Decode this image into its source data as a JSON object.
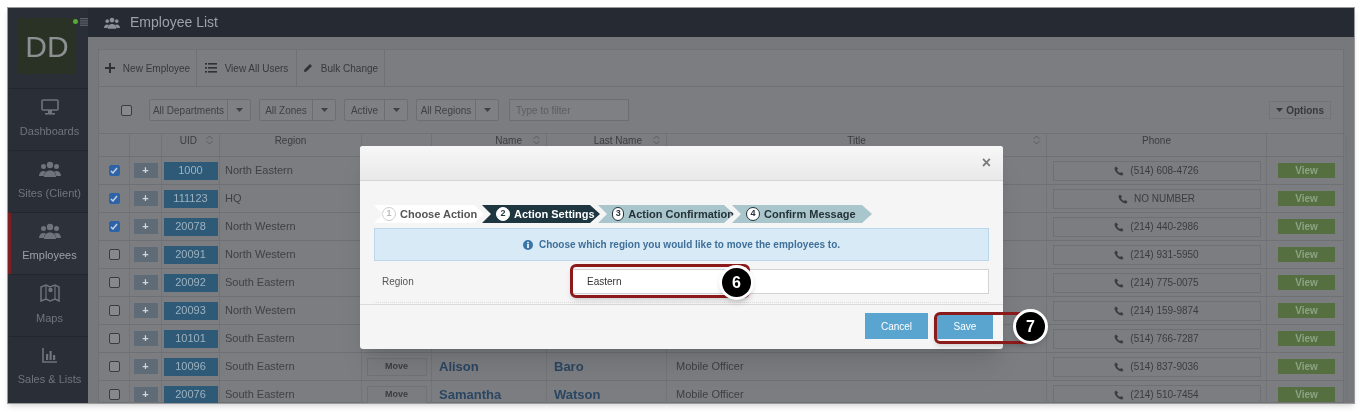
{
  "sidebar": {
    "avatar": "DD",
    "online": true,
    "items": [
      {
        "label": "Dashboards",
        "selected": false
      },
      {
        "label": "Sites (Client)",
        "selected": false
      },
      {
        "label": "Employees",
        "selected": true
      },
      {
        "label": "Maps",
        "selected": false
      },
      {
        "label": "Sales & Lists",
        "selected": false
      }
    ]
  },
  "header": {
    "title": "Employee List"
  },
  "toolbar": [
    "New Employee",
    "View All Users",
    "Bulk Change"
  ],
  "filters": {
    "select_all_checked": false,
    "dropdowns": [
      "All Departments",
      "All Zones",
      "Active",
      "All Regions"
    ],
    "search": {
      "placeholder": "Type to filter"
    },
    "options_button": "Options"
  },
  "table": {
    "columns": [
      {
        "label": "UID",
        "sortable": true
      },
      {
        "label": "Region",
        "sortable": false
      },
      {
        "label": "Name",
        "sortable": true
      },
      {
        "label": "Last Name",
        "sortable": true
      },
      {
        "label": "Title",
        "sortable": true
      },
      {
        "label": "Phone",
        "sortable": false
      }
    ],
    "rows": [
      {
        "checked": true,
        "expand": "+",
        "uid": "1000",
        "region": "North Eastern",
        "phone": "(514) 608-4726",
        "view": "View"
      },
      {
        "checked": true,
        "expand": "+",
        "uid": "111123",
        "region": "HQ",
        "phone": "NO NUMBER",
        "view": "View"
      },
      {
        "checked": true,
        "expand": "+",
        "uid": "20078",
        "region": "North Western",
        "phone": "(214) 440-2986",
        "view": "View"
      },
      {
        "checked": false,
        "expand": "+",
        "uid": "20091",
        "region": "North Western",
        "phone": "(214) 931-5950",
        "view": "View"
      },
      {
        "checked": false,
        "expand": "+",
        "uid": "20092",
        "region": "South Eastern",
        "phone": "(214) 775-0075",
        "view": "View"
      },
      {
        "checked": false,
        "expand": "+",
        "uid": "20093",
        "region": "North Western",
        "phone": "(214) 159-9874",
        "view": "View"
      },
      {
        "checked": false,
        "expand": "+",
        "uid": "10101",
        "region": "South Eastern",
        "phone": "(514) 766-7287",
        "view": "View"
      },
      {
        "checked": false,
        "expand": "+",
        "uid": "10096",
        "region": "South Eastern",
        "move": "Move",
        "first_name": "Alison",
        "last_name": "Baro",
        "title": "Mobile Officer",
        "phone": "(514) 837-9036",
        "view": "View"
      },
      {
        "checked": false,
        "expand": "+",
        "uid": "20076",
        "region": "South Eastern",
        "move": "Move",
        "first_name": "Samantha",
        "last_name": "Watson",
        "title": "Mobile Officer",
        "phone": "(214) 510-7454",
        "view": "View"
      }
    ]
  },
  "modal": {
    "close": "×",
    "steps": [
      {
        "number": "1",
        "label": "Choose Action",
        "selected": false,
        "completed": true
      },
      {
        "number": "2",
        "label": "Action Settings",
        "selected": true,
        "completed": false
      },
      {
        "number": "3",
        "label": "Action Confirmation",
        "selected": false,
        "completed": false
      },
      {
        "number": "4",
        "label": "Confirm Message",
        "selected": false,
        "completed": false
      }
    ],
    "info": "Choose which region you would like to move the employees to.",
    "field": {
      "label": "Region",
      "value": "Eastern"
    },
    "buttons": [
      "Cancel",
      "Save"
    ]
  },
  "callouts": [
    {
      "number": "6"
    },
    {
      "number": "7"
    }
  ]
}
